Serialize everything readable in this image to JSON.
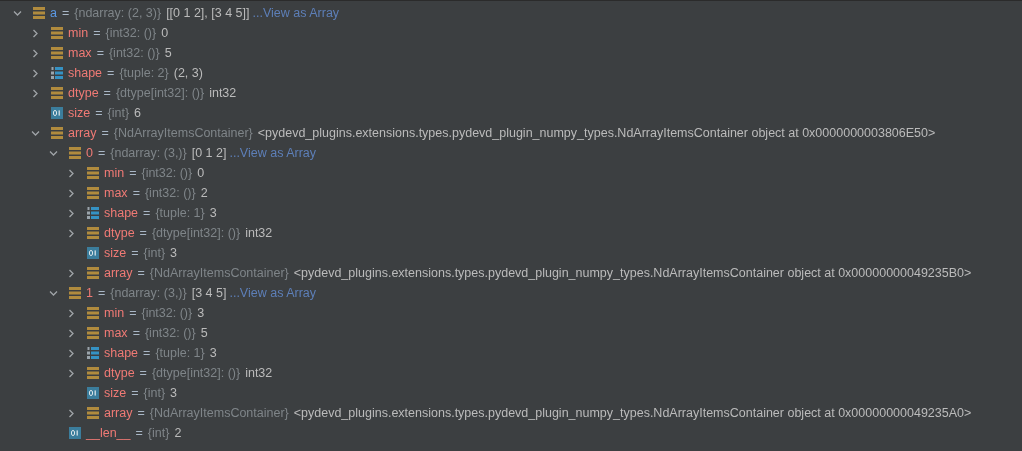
{
  "variables": [
    {
      "name": "a",
      "operator": "=",
      "type": "{ndarray: (2, 3)}",
      "value": "[[0 1 2], [3 4 5]]",
      "link": "...View as Array",
      "kind": "ndarray",
      "expanded": true,
      "children": [
        {
          "name": "min",
          "operator": "=",
          "type": "{int32: ()}",
          "value": "0",
          "kind": "ndarray",
          "expanded": false
        },
        {
          "name": "max",
          "operator": "=",
          "type": "{int32: ()}",
          "value": "5",
          "kind": "ndarray",
          "expanded": false
        },
        {
          "name": "shape",
          "operator": "=",
          "type": "{tuple: 2}",
          "value": "(2, 3)",
          "kind": "tuple",
          "expanded": false
        },
        {
          "name": "dtype",
          "operator": "=",
          "type": "{dtype[int32]: ()}",
          "value": "int32",
          "kind": "ndarray",
          "expanded": false
        },
        {
          "name": "size",
          "operator": "=",
          "type": "{int}",
          "value": "6",
          "kind": "int"
        },
        {
          "name": "array",
          "operator": "=",
          "type": "{NdArrayItemsContainer}",
          "value": "<pydevd_plugins.extensions.types.pydevd_plugin_numpy_types.NdArrayItemsContainer object at 0x0000000003806E50>",
          "kind": "ndarray",
          "expanded": true,
          "children": [
            {
              "name": "0",
              "operator": "=",
              "type": "{ndarray: (3,)}",
              "value": "[0 1 2]",
              "link": "...View as Array",
              "kind": "ndarray",
              "expanded": true,
              "children": [
                {
                  "name": "min",
                  "operator": "=",
                  "type": "{int32: ()}",
                  "value": "0",
                  "kind": "ndarray",
                  "expanded": false
                },
                {
                  "name": "max",
                  "operator": "=",
                  "type": "{int32: ()}",
                  "value": "2",
                  "kind": "ndarray",
                  "expanded": false
                },
                {
                  "name": "shape",
                  "operator": "=",
                  "type": "{tuple: 1}",
                  "value": "3",
                  "kind": "tuple",
                  "expanded": false
                },
                {
                  "name": "dtype",
                  "operator": "=",
                  "type": "{dtype[int32]: ()}",
                  "value": "int32",
                  "kind": "ndarray",
                  "expanded": false
                },
                {
                  "name": "size",
                  "operator": "=",
                  "type": "{int}",
                  "value": "3",
                  "kind": "int"
                },
                {
                  "name": "array",
                  "operator": "=",
                  "type": "{NdArrayItemsContainer}",
                  "value": "<pydevd_plugins.extensions.types.pydevd_plugin_numpy_types.NdArrayItemsContainer object at 0x00000000049235B0>",
                  "kind": "ndarray",
                  "expanded": false
                }
              ]
            },
            {
              "name": "1",
              "operator": "=",
              "type": "{ndarray: (3,)}",
              "value": "[3 4 5]",
              "link": "...View as Array",
              "kind": "ndarray",
              "expanded": true,
              "children": [
                {
                  "name": "min",
                  "operator": "=",
                  "type": "{int32: ()}",
                  "value": "3",
                  "kind": "ndarray",
                  "expanded": false
                },
                {
                  "name": "max",
                  "operator": "=",
                  "type": "{int32: ()}",
                  "value": "5",
                  "kind": "ndarray",
                  "expanded": false
                },
                {
                  "name": "shape",
                  "operator": "=",
                  "type": "{tuple: 1}",
                  "value": "3",
                  "kind": "tuple",
                  "expanded": false
                },
                {
                  "name": "dtype",
                  "operator": "=",
                  "type": "{dtype[int32]: ()}",
                  "value": "int32",
                  "kind": "ndarray",
                  "expanded": false
                },
                {
                  "name": "size",
                  "operator": "=",
                  "type": "{int}",
                  "value": "3",
                  "kind": "int"
                },
                {
                  "name": "array",
                  "operator": "=",
                  "type": "{NdArrayItemsContainer}",
                  "value": "<pydevd_plugins.extensions.types.pydevd_plugin_numpy_types.NdArrayItemsContainer object at 0x00000000049235A0>",
                  "kind": "ndarray",
                  "expanded": false
                }
              ]
            },
            {
              "name": "__len__",
              "operator": "=",
              "type": "{int}",
              "value": "2",
              "kind": "int"
            }
          ]
        }
      ]
    }
  ]
}
